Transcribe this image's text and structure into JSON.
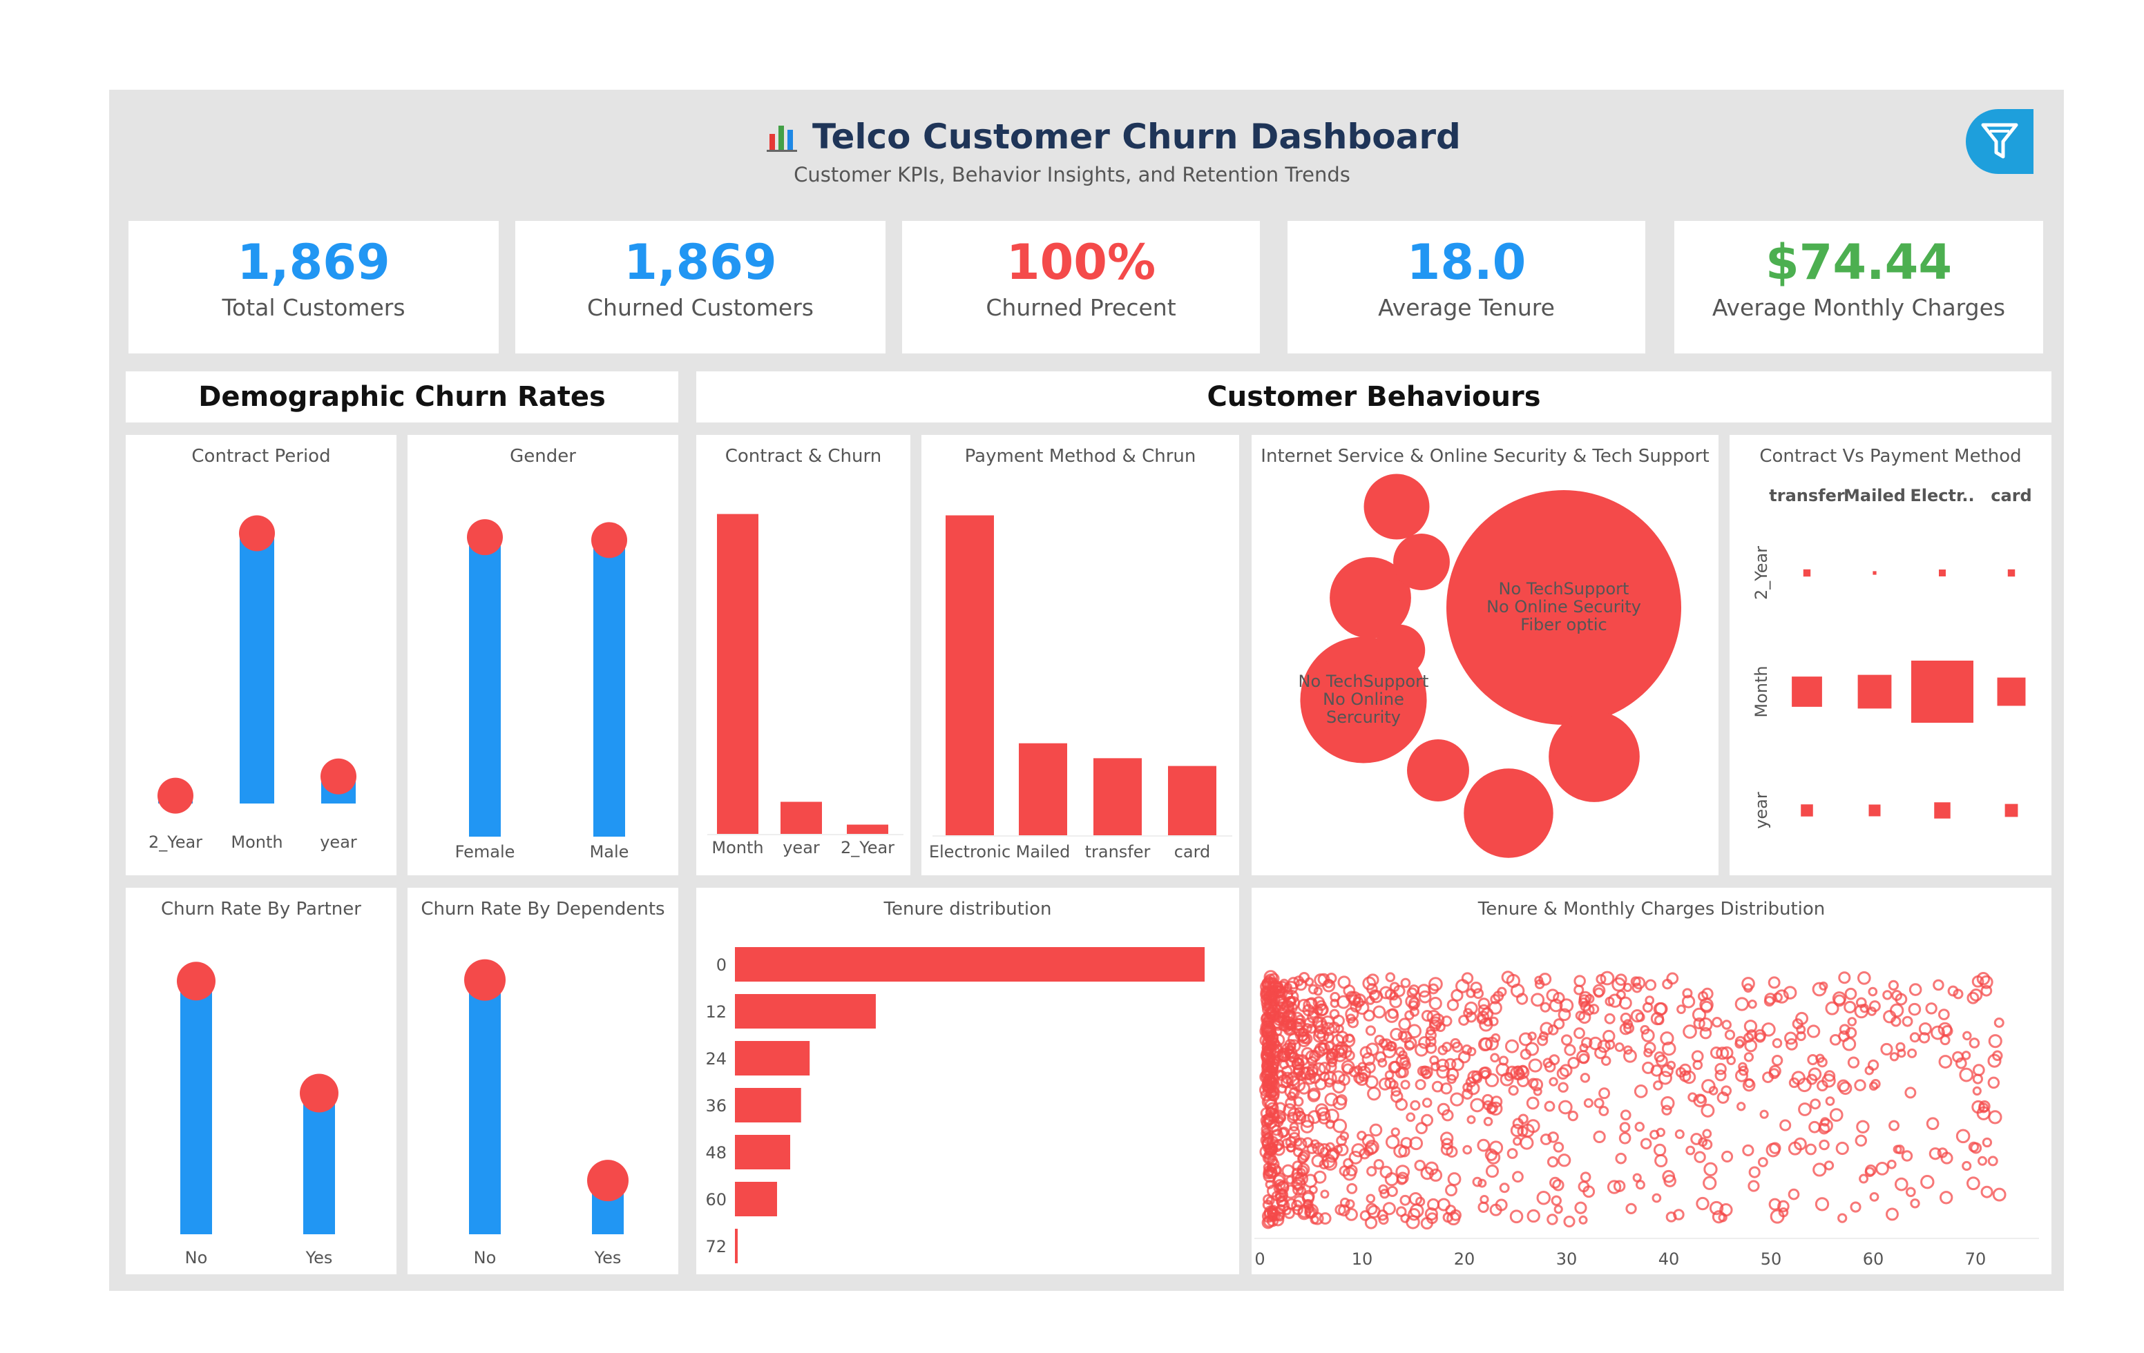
{
  "header": {
    "title": "Telco Customer Churn Dashboard",
    "subtitle": "Customer KPIs, Behavior Insights, and Retention Trends",
    "icon": "bar-chart-icon",
    "filter_icon": "funnel-icon"
  },
  "kpis": [
    {
      "value": "1,869",
      "label": "Total Customers",
      "color": "#2196f3"
    },
    {
      "value": "1,869",
      "label": "Churned Customers",
      "color": "#2196f3"
    },
    {
      "value": "100%",
      "label": "Churned Precent",
      "color": "#f44a4a"
    },
    {
      "value": "18.0",
      "label": "Average Tenure",
      "color": "#2196f3"
    },
    {
      "value": "$74.44",
      "label": "Average Monthly Charges",
      "color": "#4caf50"
    }
  ],
  "sections": {
    "demographic": "Demographic Churn Rates",
    "behaviours": "Customer Behaviours"
  },
  "colors": {
    "blue": "#2196f3",
    "red": "#f44a4a",
    "dashboard_bg": "#e4e4e4"
  },
  "chart_data": [
    {
      "id": "contract_period",
      "type": "bar",
      "title": "Contract Period",
      "categories": [
        "2_Year",
        "Month",
        "year"
      ],
      "values": [
        48,
        1655,
        166
      ],
      "ylim": [
        0,
        1750
      ],
      "marker": "circle"
    },
    {
      "id": "gender",
      "type": "bar",
      "title": "Gender",
      "categories": [
        "Female",
        "Male"
      ],
      "values": [
        939,
        930
      ],
      "ylim": [
        0,
        1000
      ],
      "marker": "circle"
    },
    {
      "id": "partner",
      "type": "bar",
      "title": "Churn Rate By Partner",
      "categories": [
        "No",
        "Yes"
      ],
      "values": [
        1200,
        669
      ],
      "ylim": [
        0,
        1250
      ],
      "marker": "circle"
    },
    {
      "id": "dependents",
      "type": "bar",
      "title": "Churn Rate By Dependents",
      "categories": [
        "No",
        "Yes"
      ],
      "values": [
        1543,
        326
      ],
      "ylim": [
        0,
        1600
      ],
      "marker": "circle"
    },
    {
      "id": "contract_churn",
      "type": "bar",
      "title": "Contract & Churn",
      "categories": [
        "Month",
        "year",
        "2_Year"
      ],
      "values": [
        1655,
        166,
        48
      ],
      "ylim": [
        0,
        1700
      ]
    },
    {
      "id": "payment_churn",
      "type": "bar",
      "title": "Payment Method & Chrun",
      "categories": [
        "Electronic",
        "Mailed",
        "transfer",
        "card"
      ],
      "values": [
        1071,
        308,
        258,
        232
      ],
      "ylim": [
        0,
        1100
      ]
    },
    {
      "id": "internet_bubbles",
      "type": "bubble",
      "title": "Internet Service & Online Security & Tech Support",
      "bubbles": [
        {
          "label": "No TechSupport\nNo Online Security\nFiber optic",
          "value": 1000
        },
        {
          "label": "No TechSupport\nNo Online\nSercurity",
          "value": 290
        },
        {
          "label": "",
          "value": 145
        },
        {
          "label": "",
          "value": 150
        },
        {
          "label": "",
          "value": 120
        },
        {
          "label": "",
          "value": 78
        },
        {
          "label": "",
          "value": 70
        },
        {
          "label": "",
          "value": 58
        },
        {
          "label": "",
          "value": 48
        }
      ]
    },
    {
      "id": "contract_payment",
      "type": "heatmap",
      "title": "Contract Vs Payment Method",
      "columns": [
        "transfer",
        "Mailed",
        "Electr..",
        "card"
      ],
      "rows": [
        "2_Year",
        "Month",
        "year"
      ],
      "values": [
        [
          12,
          3,
          11,
          12
        ],
        [
          212,
          263,
          895,
          185
        ],
        [
          34,
          32,
          61,
          39
        ]
      ]
    },
    {
      "id": "tenure_dist",
      "type": "bar",
      "orientation": "horizontal",
      "title": "Tenure distribution",
      "categories": [
        "0",
        "12",
        "24",
        "36",
        "48",
        "60",
        "72"
      ],
      "values": [
        1037,
        311,
        165,
        146,
        122,
        93,
        5
      ],
      "xlim": [
        0,
        1040
      ]
    },
    {
      "id": "tenure_charges",
      "type": "scatter",
      "title": "Tenure &  Monthly Charges Distribution",
      "xticks": [
        0,
        10,
        20,
        30,
        40,
        50,
        60,
        70
      ],
      "xlim": [
        0,
        75
      ],
      "ylim": [
        18,
        120
      ]
    }
  ]
}
